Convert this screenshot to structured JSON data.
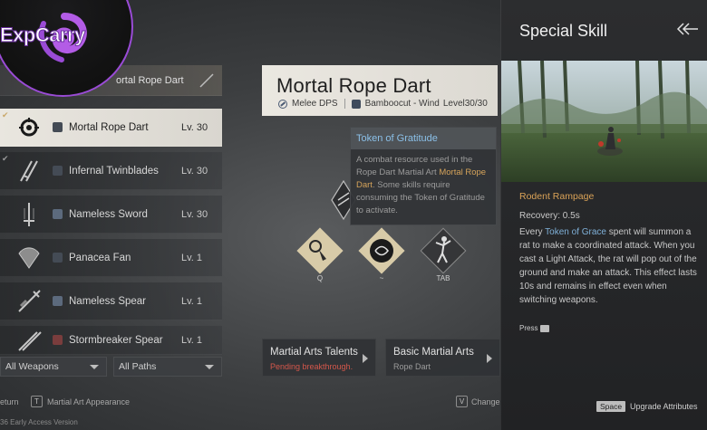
{
  "left_list": {
    "top_banner_name": "ortal Rope Dart",
    "weapons": [
      {
        "name": "Mortal Rope Dart",
        "level": "Lv. 30",
        "selected": true
      },
      {
        "name": "Infernal Twinblades",
        "level": "Lv. 30",
        "selected": false
      },
      {
        "name": "Nameless Sword",
        "level": "Lv. 30",
        "selected": false
      },
      {
        "name": "Panacea Fan",
        "level": "Lv. 1",
        "selected": false
      },
      {
        "name": "Nameless Spear",
        "level": "Lv. 1",
        "selected": false
      },
      {
        "name": "Stormbreaker Spear",
        "level": "Lv. 1",
        "selected": false
      }
    ],
    "filters": {
      "weapons": "All Weapons",
      "paths": "All Paths"
    }
  },
  "footer": {
    "return_label": "eturn",
    "appearance_key": "T",
    "appearance_label": "Martial Art Appearance",
    "change_key": "V",
    "change_label": "Change",
    "version": "36 Early Access Version"
  },
  "weapon_header": {
    "title": "Mortal Rope Dart",
    "role": "Melee DPS",
    "path": "Bamboocut - Wind",
    "level": "Level30/30"
  },
  "tooltip": {
    "title": "Token of Gratitude",
    "body_1": "A combat resource used in the Rope Dart Martial Art ",
    "body_highlight": "Mortal Rope Dart",
    "body_2": ". Some skills require consuming the Token of Gratitude to activate."
  },
  "skills": {
    "slot1_key": "Q",
    "slot2_key": "~",
    "slot3_key": "TAB"
  },
  "bottom_cards": [
    {
      "title": "Martial Arts Talents",
      "subtitle": "Pending breakthrough."
    },
    {
      "title": "Basic Martial Arts",
      "subtitle": "Rope Dart"
    }
  ],
  "special_skill": {
    "panel_title": "Special Skill",
    "skill_name": "Rodent Rampage",
    "recovery": "Recovery: 0.5s",
    "desc_1": "Every ",
    "desc_highlight": "Token of Grace",
    "desc_2": " spent will summon a rat to make a coordinated attack. When you cast a Light Attack, the rat will pop out of the ground and make an attack. This effect lasts 10s and remains in effect even when switching weapons.",
    "press_label": "Press",
    "space_key": "Space",
    "upgrade_label": "Upgrade Attributes"
  },
  "logo": {
    "text": "ExpCarry"
  },
  "colors": {
    "accent_gold": "#d9a257",
    "accent_blue": "#8bc0e8",
    "warning_red": "#d4574b",
    "logo_purple": "#9a4bd6"
  }
}
